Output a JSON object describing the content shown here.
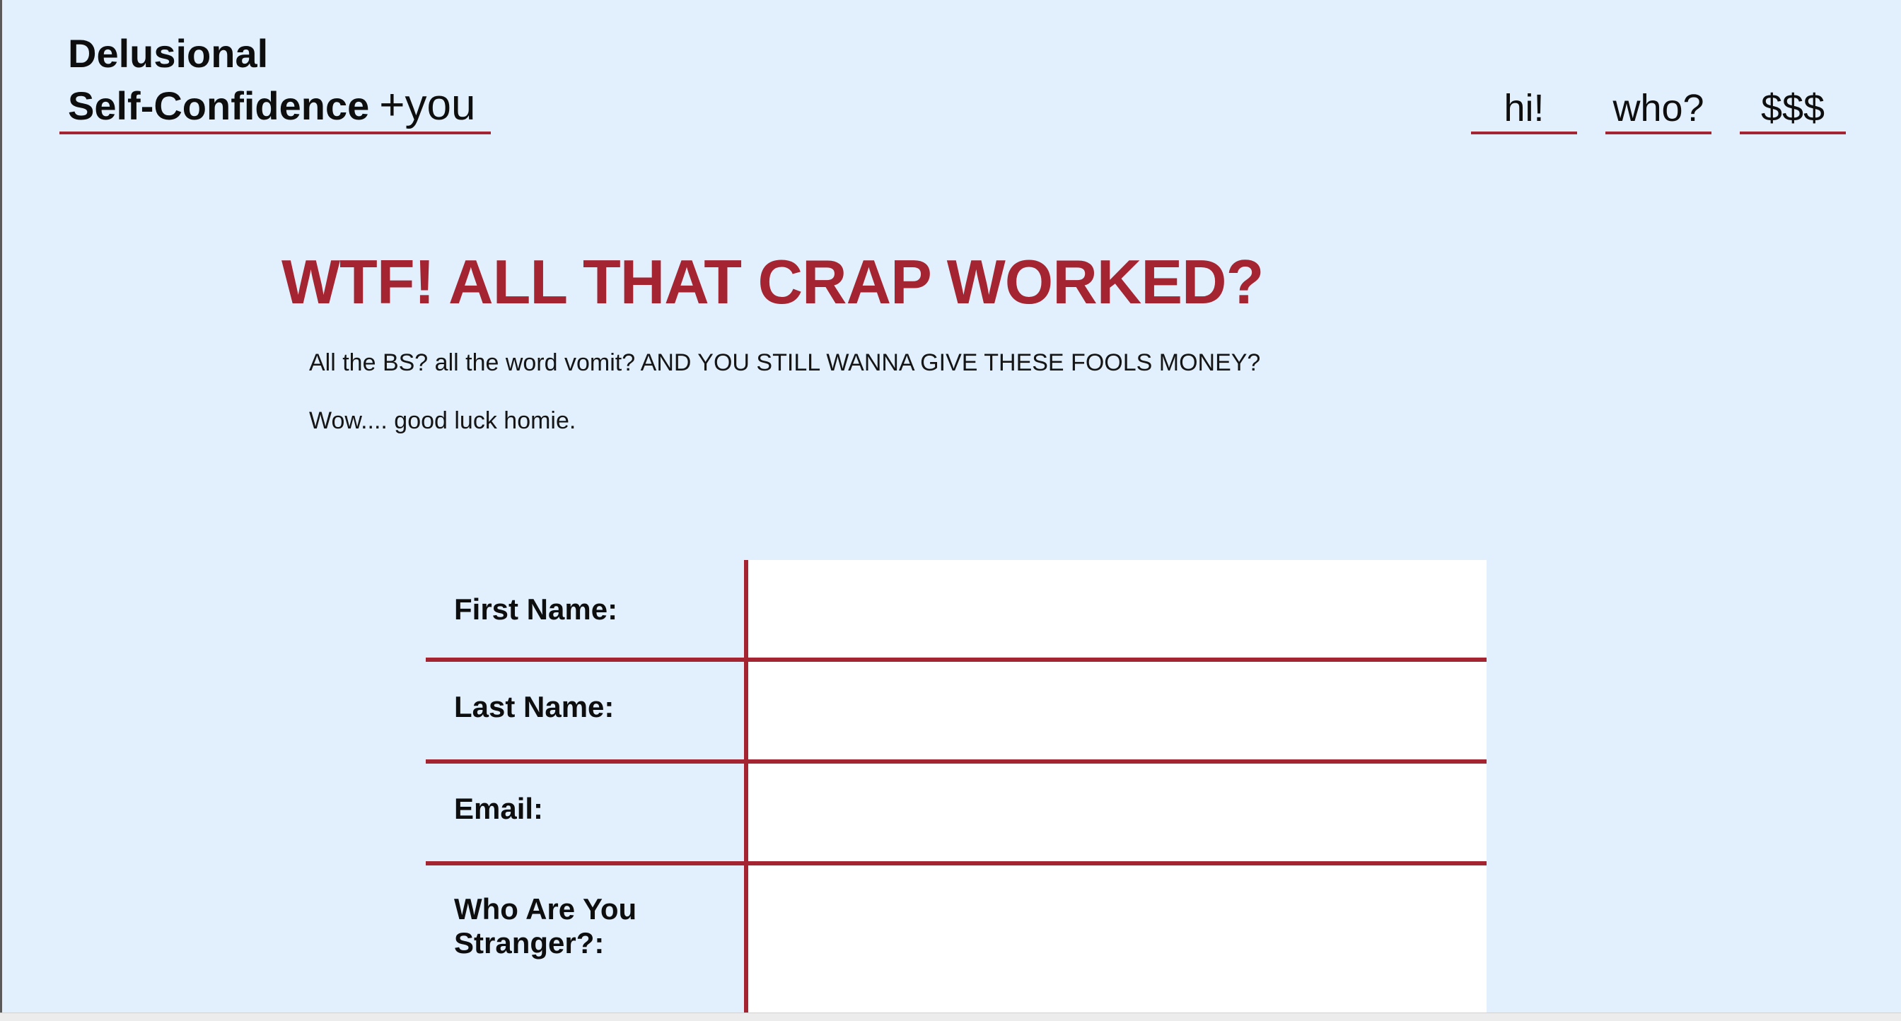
{
  "brand": {
    "line1": "Delusional",
    "line2_bold": "Self-Confidence",
    "line2_suffix": "+you"
  },
  "nav": {
    "items": [
      {
        "label": "hi!"
      },
      {
        "label": "who?"
      },
      {
        "label": "$$$"
      }
    ]
  },
  "main": {
    "headline": "WTF! ALL THAT CRAP WORKED?",
    "paragraph_1": "All the BS? all the word vomit? AND YOU STILL WANNA GIVE THESE FOOLS MONEY?",
    "paragraph_2": "Wow.... good luck homie."
  },
  "form": {
    "first_name_label": "First Name:",
    "first_name_value": "",
    "last_name_label": "Last Name:",
    "last_name_value": "",
    "email_label": "Email:",
    "email_value": "",
    "who_label_line1": "Who Are You",
    "who_label_line2": "Stranger?:",
    "who_value": ""
  },
  "colors": {
    "background": "#e2f0fd",
    "accent": "#a52431",
    "text": "#0e0e0e",
    "input_bg": "#ffffff"
  }
}
